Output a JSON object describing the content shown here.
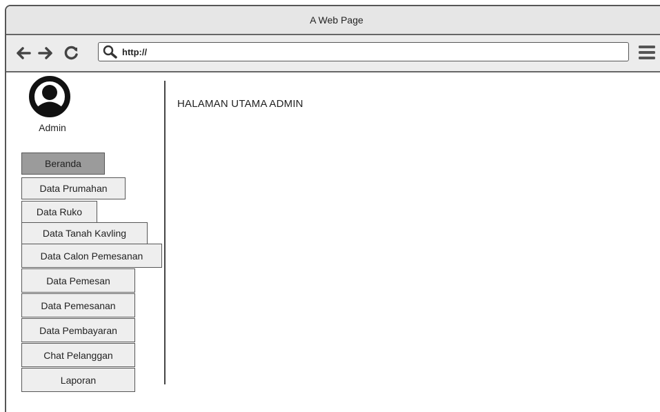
{
  "window": {
    "title": "A Web Page"
  },
  "browser": {
    "url": "http://"
  },
  "user": {
    "name": "Admin"
  },
  "sidebar": {
    "items": [
      {
        "label": "Beranda",
        "active": true
      },
      {
        "label": "Data Prumahan"
      },
      {
        "label": "Data Ruko"
      },
      {
        "label": "Data Tanah Kavling"
      },
      {
        "label": "Data Calon Pemesanan"
      },
      {
        "label": "Data Pemesan"
      },
      {
        "label": "Data Pemesanan"
      },
      {
        "label": "Data Pembayaran"
      },
      {
        "label": "Chat Pelanggan"
      },
      {
        "label": "Laporan"
      }
    ]
  },
  "main": {
    "title": "HALAMAN UTAMA ADMIN"
  }
}
